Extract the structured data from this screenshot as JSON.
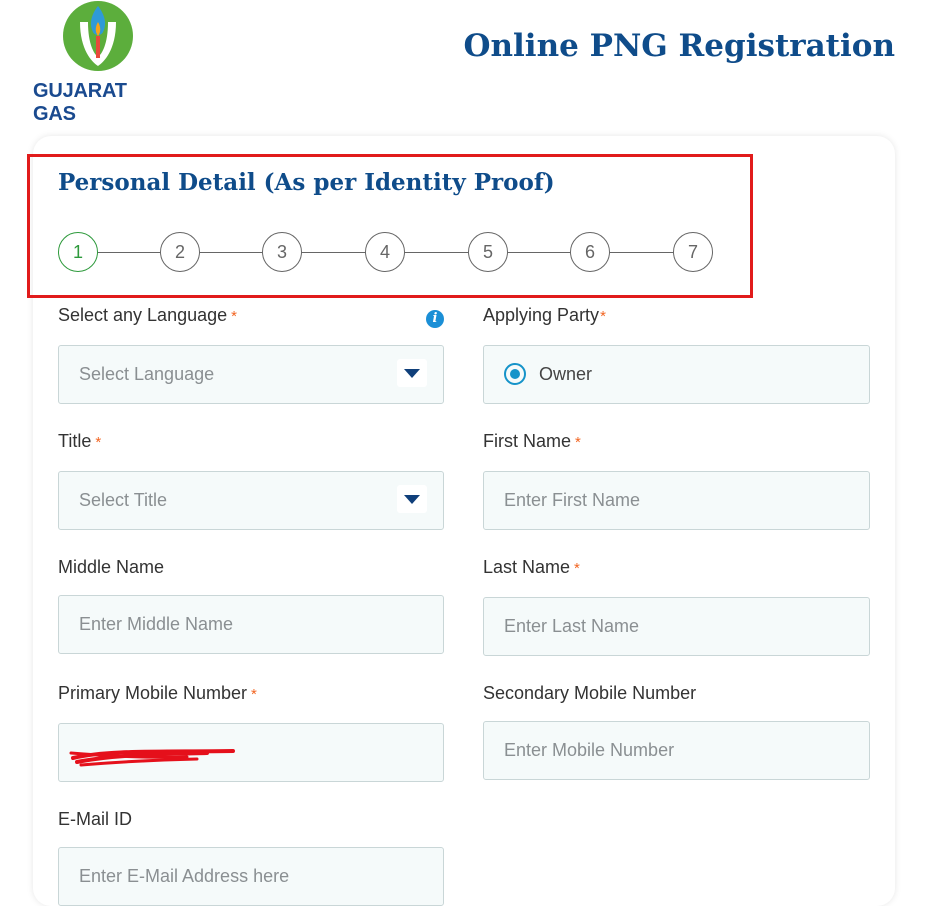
{
  "header": {
    "logo_text": "GUJARAT GAS",
    "title": "Online PNG Registration"
  },
  "section": {
    "title": "Personal Detail (As per Identity Proof)"
  },
  "stepper": {
    "steps": [
      "1",
      "2",
      "3",
      "4",
      "5",
      "6",
      "7"
    ],
    "active_step": 1
  },
  "form": {
    "language": {
      "label": "Select any Language",
      "required_mark": "*",
      "placeholder": "Select Language"
    },
    "applying_party": {
      "label": "Applying Party",
      "required_mark": "*",
      "option": "Owner"
    },
    "title": {
      "label": "Title",
      "required_mark": "*",
      "placeholder": "Select Title"
    },
    "first_name": {
      "label": "First Name",
      "required_mark": "*",
      "placeholder": "Enter First Name"
    },
    "middle_name": {
      "label": "Middle Name",
      "placeholder": "Enter Middle Name"
    },
    "last_name": {
      "label": "Last Name",
      "required_mark": "*",
      "placeholder": "Enter Last Name"
    },
    "primary_mobile": {
      "label": "Primary Mobile Number",
      "required_mark": "*"
    },
    "secondary_mobile": {
      "label": "Secondary Mobile Number",
      "placeholder": "Enter Mobile Number"
    },
    "email": {
      "label": "E-Mail ID",
      "placeholder": "Enter E-Mail Address here"
    }
  },
  "icons": {
    "logo": "gujarat-gas-flame-logo",
    "info": "info-icon",
    "dropdown": "chevron-down-icon",
    "radio": "radio-selected-icon"
  },
  "colors": {
    "brand_blue": "#0f4c8a",
    "logo_green": "#5cae3c",
    "highlight_red": "#e11b1b",
    "active_step_green": "#2e9a3c",
    "required_orange": "#f26522",
    "radio_blue": "#1593c9"
  }
}
